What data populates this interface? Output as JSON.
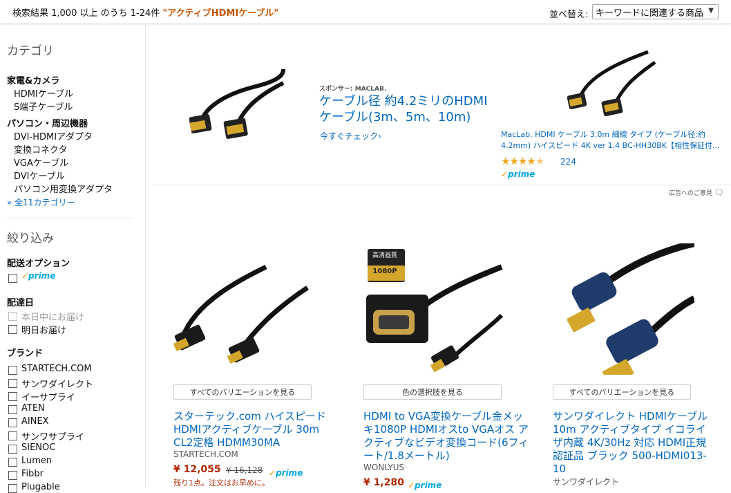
{
  "header": {
    "result_prefix": "検索結果 1,000 以上 のうち 1-24件",
    "query": "\"アクティブHDMIケーブル\"",
    "sort_label": "並べ替え:",
    "sort_value": "キーワードに関連する商品"
  },
  "sidebar": {
    "category_heading": "カテゴリ",
    "groups": [
      {
        "title": "家電&カメラ",
        "items": [
          "HDMIケーブル",
          "S端子ケーブル"
        ]
      },
      {
        "title": "パソコン・周辺機器",
        "items": [
          "DVI-HDMIアダプタ",
          "変換コネクタ",
          "VGAケーブル",
          "DVIケーブル",
          "パソコン用変換アダプタ"
        ]
      }
    ],
    "more_categories": "全11カテゴリー",
    "filter_heading": "絞り込み",
    "shipping_heading": "配送オプション",
    "prime_label": "prime",
    "delivery_heading": "配達日",
    "delivery_options": [
      "本日中にお届け",
      "明日お届け"
    ],
    "brand_heading": "ブランド",
    "brands": [
      "STARTECH.COM",
      "サンワダイレクト",
      "イーサプライ",
      "ATEN",
      "AINEX",
      "サンワサプライ",
      "SIENOC",
      "Lumen",
      "Fibbr",
      "Plugable"
    ]
  },
  "sponsored": {
    "sponsor_label": "スポンサー: MACLAB.",
    "headline": "ケーブル径 約4.2ミリのHDMIケーブル(3m、5m、10m)",
    "cta": "今すぐチェック›",
    "product_title": "MacLab. HDMI ケーブル 3.0m 細線 タイプ (ケーブル径:約4.2mm) ハイスピード 4K ver 1.4 BC-HH30BK【相性保証付...",
    "rating": 4.5,
    "rating_count": "224",
    "prime_label": "prime",
    "feedback": "広告へのご意見"
  },
  "products": [
    {
      "variation_button": "すべてのバリエーションを見る",
      "title": "スターテック.com ハイスピードHDMIアクティブケーブル 30m CL2定格 HDMM30MA",
      "brand": "STARTECH.COM",
      "price": "¥ 12,055",
      "old_price": "¥ 16,128",
      "prime_label": "prime",
      "stock": "残り1点。注文はお早めに。"
    },
    {
      "variation_button": "色の選択肢を見る",
      "title": "HDMI to VGA変換ケーブル金メッキ1080P HDMIオスto VGAオス アクティブなビデオ変換コード(6フィート/1.8メートル)",
      "brand": "WONLYUS",
      "price": "¥ 1,280",
      "prime_label": "prime",
      "badge_top": "高清画質",
      "badge_bottom": "1080P"
    },
    {
      "variation_button": "すべてのバリエーションを見る",
      "title": "サンワダイレクト HDMIケーブル 10m アクティブタイプ イコライザ内蔵 4K/30Hz 対応 HDMI正規認証品 ブラック 500-HDMI013-10",
      "brand": "サンワダイレクト"
    }
  ]
}
